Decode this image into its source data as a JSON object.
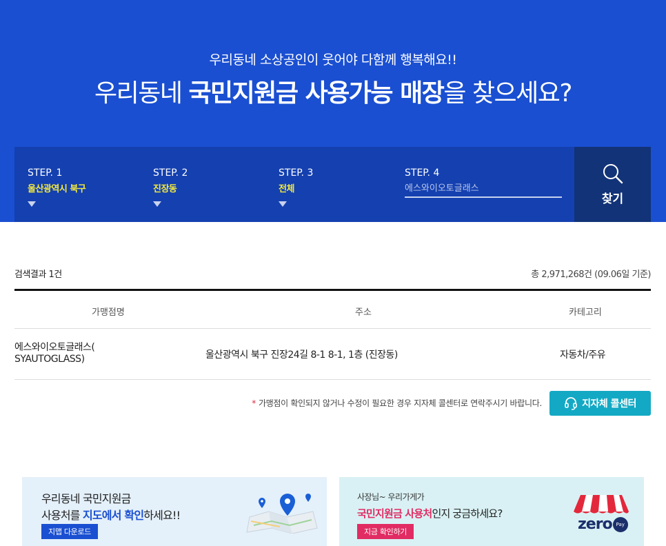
{
  "hero": {
    "subtitle": "우리동네 소상공인이 웃어야 다함께 행복해요!!",
    "title_part1": "우리동네 ",
    "title_bold": "국민지원금 사용가능 매장",
    "title_part2": "을 찾으세요?"
  },
  "search": {
    "steps": [
      {
        "label": "STEP. 1",
        "value": "울산광역시 북구"
      },
      {
        "label": "STEP. 2",
        "value": "진장동"
      },
      {
        "label": "STEP. 3",
        "value": "전체"
      },
      {
        "label": "STEP. 4",
        "placeholder": "에스와이오토글래스"
      }
    ],
    "find_label": "찾기"
  },
  "results": {
    "count_text": "검색결과 1건",
    "total_text": "총 2,971,268건 (09.06일 기준)",
    "columns": [
      "가맹점명",
      "주소",
      "카테고리"
    ],
    "rows": [
      {
        "name_line1": "에스와이오토글래스(",
        "name_line2": "SYAUTOGLASS)",
        "address": "울산광역시 북구 진장24길 8-1 8-1, 1층 (진장동)",
        "category": "자동차/주유"
      }
    ]
  },
  "notice": {
    "star": "*",
    "text": "가맹점이 확인되지 않거나 수정이 필요한 경우 지자체 콜센터로 연락주시기 바랍니다.",
    "callcenter_label": "지자체 콜센터"
  },
  "banners": {
    "left": {
      "line1": "우리동네 국민지원금",
      "line2_pre": "사용처를 ",
      "line2_bold": "지도에서 확인",
      "line2_post": "하세요!!",
      "button": "지맵 다운로드"
    },
    "right": {
      "line1": "사장님~ 우리가게가",
      "line2_bold": "국민지원금 사용처",
      "line2_post": "인지 궁금하세요?",
      "button": "지금 확인하기",
      "logo_text": "zero",
      "logo_badge": "Pay"
    }
  },
  "colors": {
    "hero_bg": "#1a4fd1",
    "search_bg": "#1440b0",
    "step_value": "#f5ea3c",
    "callcenter": "#13a9c4",
    "accent_pink": "#e12c63"
  }
}
